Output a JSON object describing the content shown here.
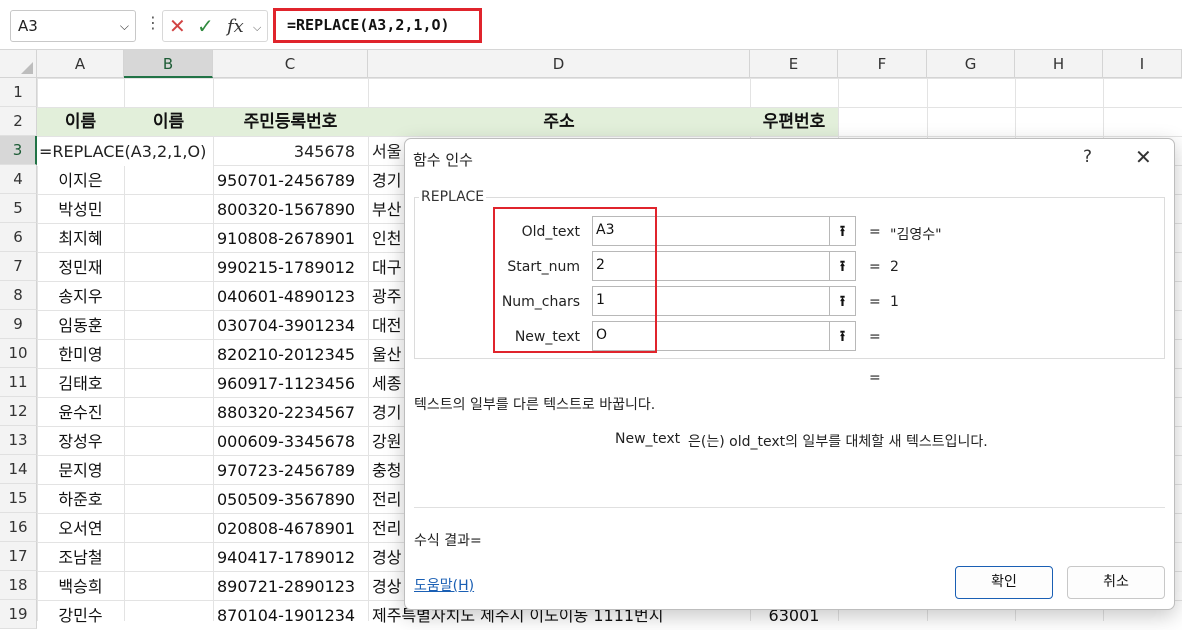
{
  "formula_bar": {
    "name_box": "A3",
    "formula": "=REPLACE(A3,2,1,O)"
  },
  "columns": [
    "A",
    "B",
    "C",
    "D",
    "E",
    "F",
    "G",
    "H",
    "I"
  ],
  "rows": [
    "1",
    "2",
    "3",
    "4",
    "5",
    "6",
    "7",
    "8",
    "9",
    "10",
    "11",
    "12",
    "13",
    "14",
    "15",
    "16",
    "17",
    "18",
    "19"
  ],
  "header_row": {
    "a": "이름",
    "b": "이름",
    "c": "주민등록번호",
    "d": "주소",
    "e": "우편번호"
  },
  "row3": {
    "edit_text": "=REPLACE(A3,2,1,O)",
    "c_fragment": "345678",
    "d_fragment": "서울"
  },
  "data_rows": [
    {
      "name": "이지은",
      "rrn": "950701-2456789",
      "addr": "경기"
    },
    {
      "name": "박성민",
      "rrn": "800320-1567890",
      "addr": "부산"
    },
    {
      "name": "최지혜",
      "rrn": "910808-2678901",
      "addr": "인천"
    },
    {
      "name": "정민재",
      "rrn": "990215-1789012",
      "addr": "대구"
    },
    {
      "name": "송지우",
      "rrn": "040601-4890123",
      "addr": "광주"
    },
    {
      "name": "임동훈",
      "rrn": "030704-3901234",
      "addr": "대전"
    },
    {
      "name": "한미영",
      "rrn": "820210-2012345",
      "addr": "울산"
    },
    {
      "name": "김태호",
      "rrn": "960917-1123456",
      "addr": "세종"
    },
    {
      "name": "윤수진",
      "rrn": "880320-2234567",
      "addr": "경기"
    },
    {
      "name": "장성우",
      "rrn": "000609-3345678",
      "addr": "강원"
    },
    {
      "name": "문지영",
      "rrn": "970723-2456789",
      "addr": "충청"
    },
    {
      "name": "하준호",
      "rrn": "050509-3567890",
      "addr": "전리"
    },
    {
      "name": "오서연",
      "rrn": "020808-4678901",
      "addr": "전리"
    },
    {
      "name": "조남철",
      "rrn": "940417-1789012",
      "addr": "경상"
    },
    {
      "name": "백승희",
      "rrn": "890721-2890123",
      "addr": "경상"
    },
    {
      "name": "강민수",
      "rrn": "870104-1901234",
      "addr": "제주특별자치도 제주시 이도이동 1111번지",
      "post": "63001"
    }
  ],
  "dialog": {
    "title": "함수 인수",
    "help_q": "?",
    "close": "✕",
    "function_name": "REPLACE",
    "args": [
      {
        "label": "Old_text",
        "value": "A3",
        "result": "\"김영수\""
      },
      {
        "label": "Start_num",
        "value": "2",
        "result": "2"
      },
      {
        "label": "Num_chars",
        "value": "1",
        "result": "1"
      },
      {
        "label": "New_text",
        "value": "O",
        "result": ""
      }
    ],
    "eq": "=",
    "description": "텍스트의 일부를 다른 텍스트로 바꿉니다.",
    "arg_desc_name": "New_text",
    "arg_desc_text": "은(는) old_text의 일부를 대체할 새 텍스트입니다.",
    "formula_result": "수식 결과=",
    "help_link": "도움말(H)",
    "ok": "확인",
    "cancel": "취소"
  }
}
